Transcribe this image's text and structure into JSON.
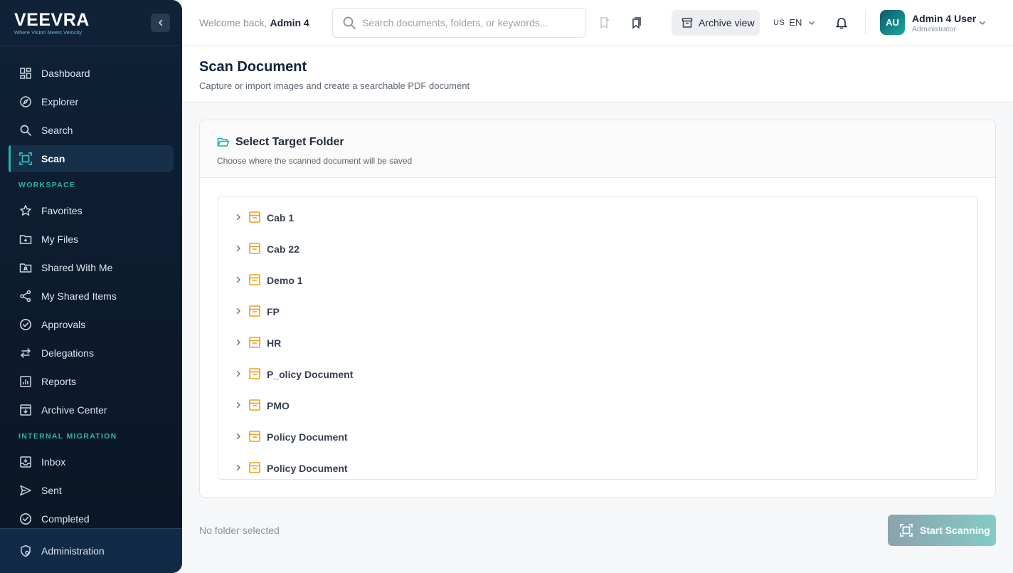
{
  "brand": {
    "name": "VEEVRA",
    "tagline": "Where Vision Meets Velocity"
  },
  "sidebar": {
    "items": [
      {
        "label": "Dashboard",
        "icon": "dashboard-icon"
      },
      {
        "label": "Explorer",
        "icon": "compass-icon"
      },
      {
        "label": "Search",
        "icon": "search-icon"
      },
      {
        "label": "Scan",
        "icon": "scan-icon",
        "active": true
      }
    ],
    "workspace_label": "WORKSPACE",
    "workspace": [
      {
        "label": "Favorites",
        "icon": "star-icon"
      },
      {
        "label": "My Files",
        "icon": "folder-user-icon"
      },
      {
        "label": "Shared With Me",
        "icon": "folder-shared-icon"
      },
      {
        "label": "My Shared Items",
        "icon": "share-icon"
      },
      {
        "label": "Approvals",
        "icon": "check-circle-icon"
      },
      {
        "label": "Delegations",
        "icon": "swap-arrows-icon"
      },
      {
        "label": "Reports",
        "icon": "chart-icon"
      },
      {
        "label": "Archive Center",
        "icon": "archive-download-icon"
      }
    ],
    "migration_label": "INTERNAL MIGRATION",
    "migration": [
      {
        "label": "Inbox",
        "icon": "inbox-icon"
      },
      {
        "label": "Sent",
        "icon": "send-icon"
      },
      {
        "label": "Completed",
        "icon": "check-circle-icon"
      }
    ],
    "bottom": {
      "label": "Administration",
      "icon": "shield-gear-icon"
    }
  },
  "header": {
    "welcome": "Welcome back,",
    "user_short": "Admin 4",
    "search_placeholder": "Search documents, folders, or keywords...",
    "archive_view": "Archive view",
    "lang_country": "US",
    "lang_code": "EN",
    "avatar": "AU",
    "user_name": "Admin 4 User",
    "user_role": "Administrator"
  },
  "page": {
    "title": "Scan Document",
    "subtitle": "Capture or import images and create a searchable PDF document"
  },
  "card": {
    "title": "Select Target Folder",
    "subtitle": "Choose where the scanned document will be saved",
    "folders": [
      "Cab 1",
      "Cab 22",
      "Demo 1",
      "FP",
      "HR",
      "P_olicy Document",
      "PMO",
      "Policy Document",
      "Policy Document"
    ]
  },
  "footer": {
    "status": "No folder selected",
    "start_label": "Start Scanning"
  },
  "colors": {
    "accent": "#27b3a8",
    "folder": "#e8a020",
    "sidebar_bg": "#0f2238"
  }
}
